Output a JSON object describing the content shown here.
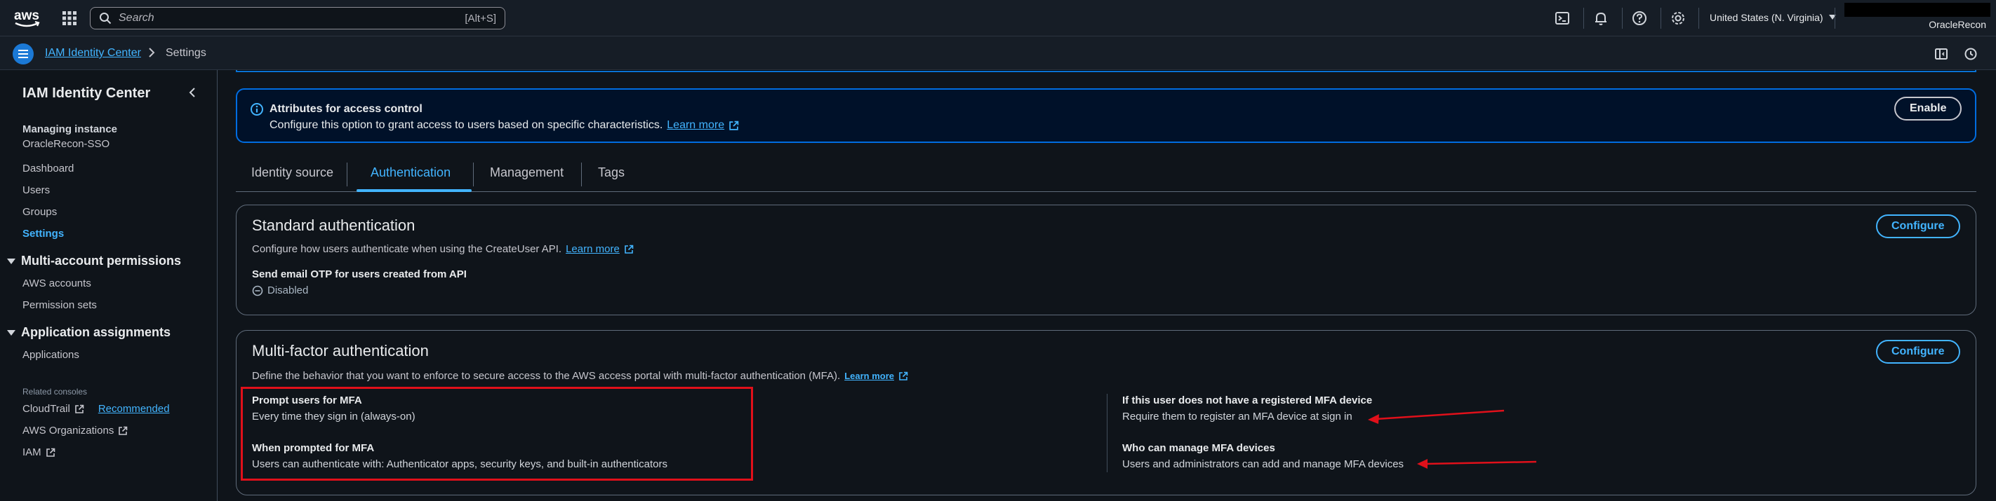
{
  "topnav": {
    "logo_text": "aws",
    "search_placeholder": "Search",
    "search_shortcut": "[Alt+S]",
    "region": "United States (N. Virginia)",
    "account": "OracleRecon",
    "icons": [
      "cloudshell-icon",
      "bell-icon",
      "help-icon",
      "gear-icon"
    ]
  },
  "breadcrumb": {
    "items": [
      "IAM Identity Center",
      "Settings"
    ]
  },
  "sidebar": {
    "title": "IAM Identity Center",
    "managing_label": "Managing instance",
    "instance_name": "OracleRecon-SSO",
    "nav": [
      "Dashboard",
      "Users",
      "Groups",
      "Settings"
    ],
    "active": "Settings",
    "sections": [
      {
        "title": "Multi-account permissions",
        "items": [
          "AWS accounts",
          "Permission sets"
        ]
      },
      {
        "title": "Application assignments",
        "items": [
          "Applications"
        ]
      }
    ],
    "related_label": "Related consoles",
    "related": [
      {
        "label": "CloudTrail",
        "badge": "Recommended"
      },
      {
        "label": "AWS Organizations"
      },
      {
        "label": "IAM"
      }
    ]
  },
  "info": {
    "title": "Attributes for access control",
    "text": "Configure this option to grant access to users based on specific characteristics.",
    "learn_more": "Learn more",
    "button": "Enable"
  },
  "tabs": [
    "Identity source",
    "Authentication",
    "Management",
    "Tags"
  ],
  "active_tab": "Authentication",
  "standard_auth": {
    "title": "Standard authentication",
    "description": "Configure how users authenticate when using the CreateUser API.",
    "learn_more": "Learn more",
    "button": "Configure",
    "setting_label": "Send email OTP for users created from API",
    "setting_value": "Disabled"
  },
  "mfa": {
    "title": "Multi-factor authentication",
    "description": "Define the behavior that you want to enforce to secure access to the AWS access portal with multi-factor authentication (MFA).",
    "learn_more": "Learn more",
    "button": "Configure",
    "left": [
      {
        "label": "Prompt users for MFA",
        "value": "Every time they sign in (always-on)"
      },
      {
        "label": "When prompted for MFA",
        "value": "Users can authenticate with: Authenticator apps, security keys, and built-in authenticators"
      }
    ],
    "right": [
      {
        "label": "If this user does not have a registered MFA device",
        "value": "Require them to register an MFA device at sign in"
      },
      {
        "label": "Who can manage MFA devices",
        "value": "Users and administrators can add and manage MFA devices"
      }
    ]
  },
  "colors": {
    "accent": "#42b4ff",
    "annotation": "#e0101a",
    "info_border": "#006ce0"
  }
}
